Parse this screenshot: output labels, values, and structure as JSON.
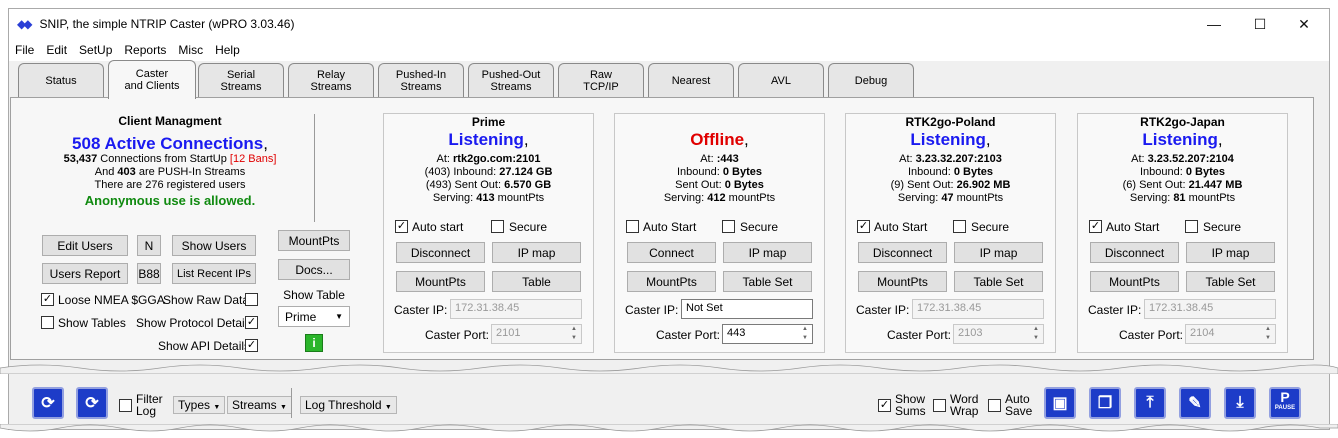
{
  "window": {
    "title": "SNIP, the simple NTRIP Caster  (wPRO 3.03.46)",
    "minimize": "—",
    "maximize": "☐",
    "close": "✕"
  },
  "menu": [
    "File",
    "Edit",
    "SetUp",
    "Reports",
    "Misc",
    "Help"
  ],
  "tabs": [
    {
      "l1": "Status",
      "l2": ""
    },
    {
      "l1": "Caster",
      "l2": "and Clients"
    },
    {
      "l1": "Serial",
      "l2": "Streams"
    },
    {
      "l1": "Relay",
      "l2": "Streams"
    },
    {
      "l1": "Pushed-In",
      "l2": "Streams"
    },
    {
      "l1": "Pushed-Out",
      "l2": "Streams"
    },
    {
      "l1": "Raw",
      "l2": "TCP/IP"
    },
    {
      "l1": "Nearest",
      "l2": ""
    },
    {
      "l1": "AVL",
      "l2": ""
    },
    {
      "l1": "Debug",
      "l2": ""
    }
  ],
  "client": {
    "heading": "Client Managment",
    "active": "508 Active Connections",
    "comma": ",",
    "startup_num": "53,437",
    "startup_text": " Connections from StartUp ",
    "bans": "[12 Bans]",
    "push_pre": "And ",
    "push_num": "403",
    "push_post": " are PUSH-In Streams",
    "registered": "There are 276 registered users",
    "anonymous": "Anonymous use is allowed.",
    "btn_edit_users": "Edit Users",
    "btn_n": "N",
    "btn_show_users": "Show Users",
    "btn_users_report": "Users Report",
    "btn_b88": "B88",
    "btn_list_recent": "List Recent IPs",
    "loose_nmea": "Loose NMEA $GGA",
    "show_raw": "Show Raw Data",
    "show_tables": "Show Tables",
    "show_protocol": "Show Protocol Details",
    "show_api": "Show API Details",
    "btn_mountpts": "MountPts",
    "btn_docs": "Docs...",
    "show_table_label": "Show Table",
    "show_table_value": "Prime",
    "info_btn": "i",
    "checks": {
      "loose_nmea": true,
      "show_raw": false,
      "show_tables": false,
      "show_protocol": true,
      "show_api": true
    }
  },
  "casters": [
    {
      "name": "Prime",
      "status": "Listening",
      "status_color": "#1a1af0",
      "at": "rtk2go.com:2101",
      "inbound_pre": "(403) Inbound: ",
      "inbound": "27.124 GB",
      "sent_pre": "(493) Sent Out: ",
      "sent": "6.570 GB",
      "serving": "413",
      "auto_start_label": "Auto start",
      "auto_start": true,
      "secure": false,
      "btn1": "Disconnect",
      "btn2": "IP map",
      "btn3": "MountPts",
      "btn4": "Table",
      "ip": "172.31.38.45",
      "port": "2101",
      "enabled": false
    },
    {
      "name": "",
      "status": "Offline",
      "status_color": "#e00000",
      "at": ":443",
      "inbound_pre": "Inbound: ",
      "inbound": "0 Bytes",
      "sent_pre": "Sent Out: ",
      "sent": "0 Bytes",
      "serving": "412",
      "auto_start_label": "Auto Start",
      "auto_start": false,
      "secure": false,
      "btn1": "Connect",
      "btn2": "IP map",
      "btn3": "MountPts",
      "btn4": "Table Set",
      "ip": "Not Set",
      "port": "443",
      "enabled": true
    },
    {
      "name": "RTK2go-Poland",
      "status": "Listening",
      "status_color": "#1a1af0",
      "at": "3.23.32.207:2103",
      "inbound_pre": "Inbound: ",
      "inbound": "0 Bytes",
      "sent_pre": "(9) Sent Out: ",
      "sent": "26.902 MB",
      "serving": "47",
      "auto_start_label": "Auto Start",
      "auto_start": true,
      "secure": false,
      "btn1": "Disconnect",
      "btn2": "IP map",
      "btn3": "MountPts",
      "btn4": "Table Set",
      "ip": "172.31.38.45",
      "port": "2103",
      "enabled": false
    },
    {
      "name": "RTK2go-Japan",
      "status": "Listening",
      "status_color": "#1a1af0",
      "at": "3.23.52.207:2104",
      "inbound_pre": "Inbound: ",
      "inbound": "0 Bytes",
      "sent_pre": "(6) Sent Out: ",
      "sent": "21.447 MB",
      "serving": "81",
      "auto_start_label": "Auto Start",
      "auto_start": true,
      "secure": false,
      "btn1": "Disconnect",
      "btn2": "IP map",
      "btn3": "MountPts",
      "btn4": "Table Set",
      "ip": "172.31.38.45",
      "port": "2104",
      "enabled": false
    }
  ],
  "caster_labels": {
    "at": "At: ",
    "serving_pre": "Serving: ",
    "serving_post": " mountPts",
    "secure": "Secure",
    "ip": "Caster IP:",
    "port": "Caster Port:"
  },
  "bottom": {
    "filter_log": "Filter\nLog",
    "filter_l1": "Filter",
    "filter_l2": "Log",
    "types": "Types",
    "streams": "Streams",
    "log_threshold": "Log Threshold",
    "show_sums_l1": "Show",
    "show_sums_l2": "Sums",
    "word_wrap_l1": "Word",
    "word_wrap_l2": "Wrap",
    "auto_save_l1": "Auto",
    "auto_save_l2": "Save",
    "show_sums": true,
    "word_wrap": false,
    "auto_save": false,
    "filter": false,
    "pause_label": "PAUSE",
    "pause_letter": "P"
  }
}
